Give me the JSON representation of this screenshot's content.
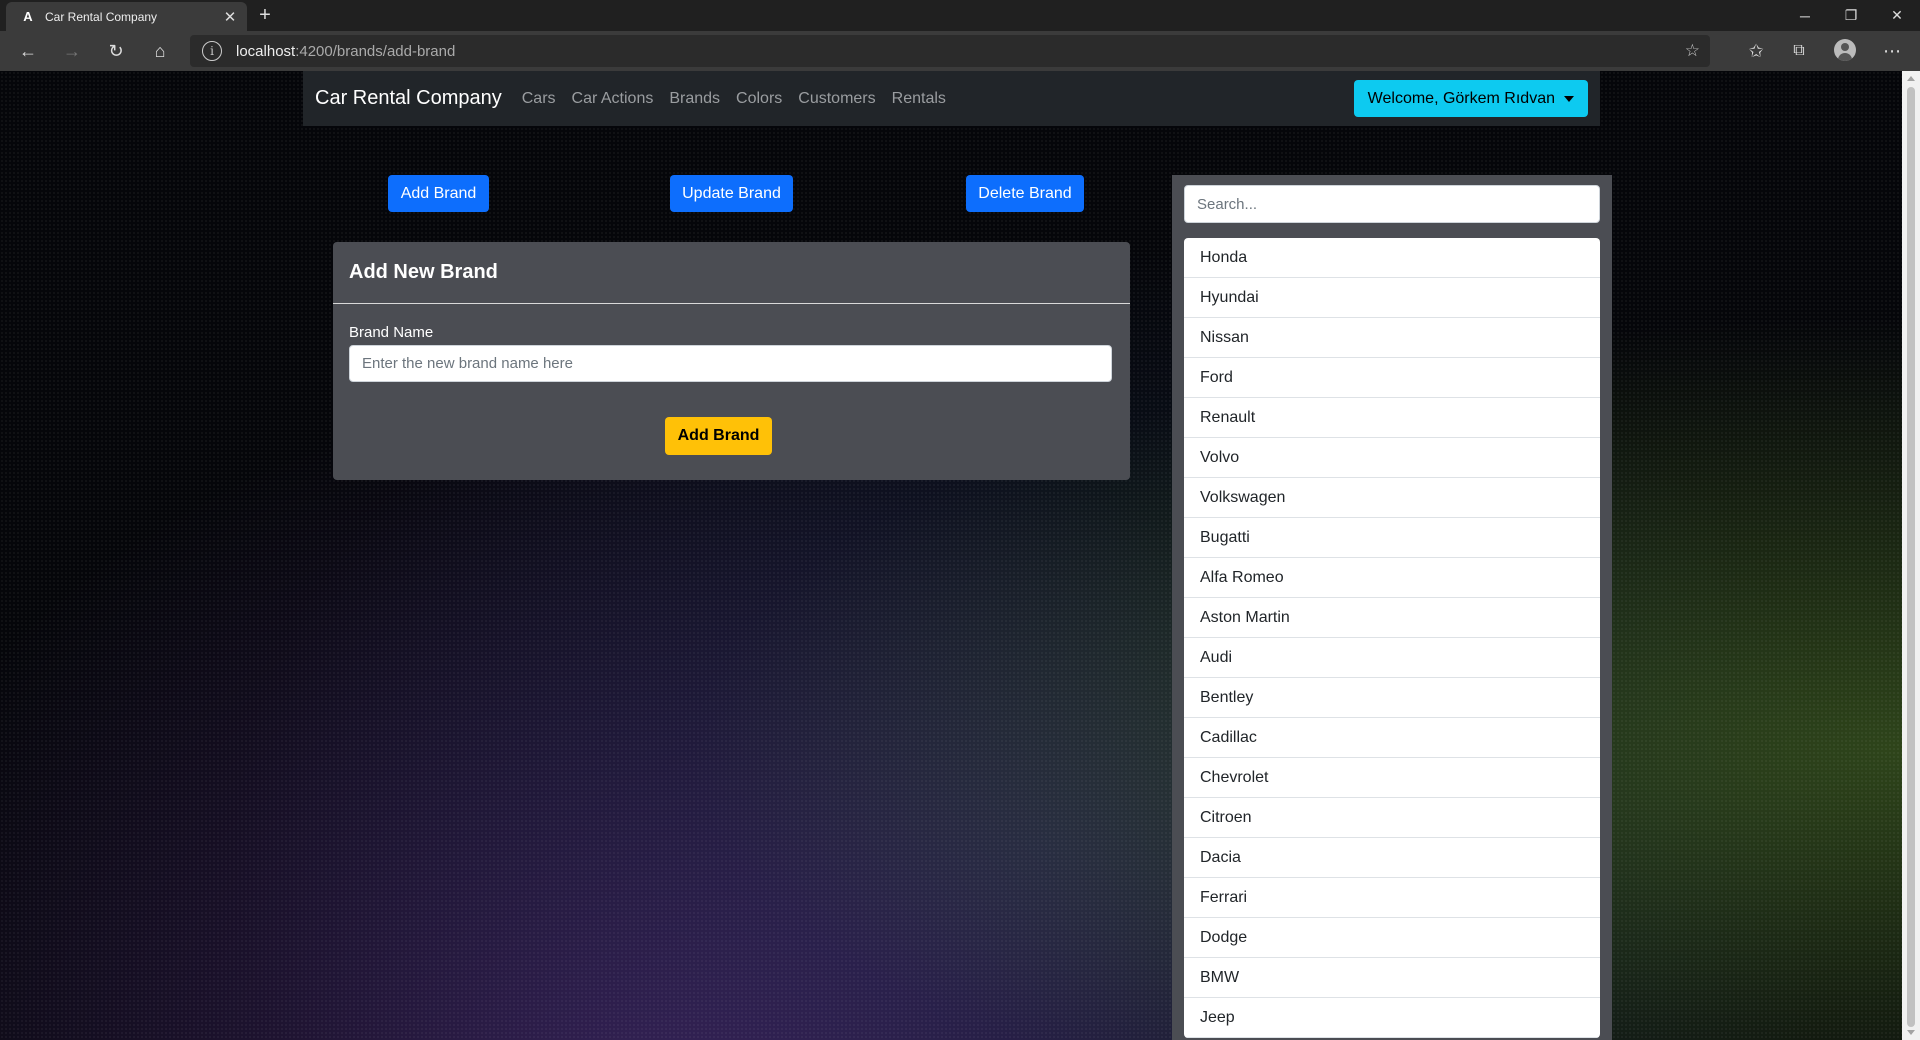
{
  "browser": {
    "tab_title": "Car Rental Company",
    "tab_favicon": "A",
    "url_host": "localhost",
    "url_path": ":4200/brands/add-brand"
  },
  "navbar": {
    "brand": "Car Rental Company",
    "links": [
      "Cars",
      "Car Actions",
      "Brands",
      "Colors",
      "Customers",
      "Rentals"
    ],
    "welcome": "Welcome, Görkem Rıdvan"
  },
  "actions": {
    "add": "Add Brand",
    "update": "Update Brand",
    "delete": "Delete Brand"
  },
  "form": {
    "title": "Add New Brand",
    "label": "Brand Name",
    "placeholder": "Enter the new brand name here",
    "submit": "Add Brand"
  },
  "sidebar": {
    "search_placeholder": "Search...",
    "brands": [
      "Honda",
      "Hyundai",
      "Nissan",
      "Ford",
      "Renault",
      "Volvo",
      "Volkswagen",
      "Bugatti",
      "Alfa Romeo",
      "Aston Martin",
      "Audi",
      "Bentley",
      "Cadillac",
      "Chevrolet",
      "Citroen",
      "Dacia",
      "Ferrari",
      "Dodge",
      "BMW",
      "Jeep"
    ]
  }
}
